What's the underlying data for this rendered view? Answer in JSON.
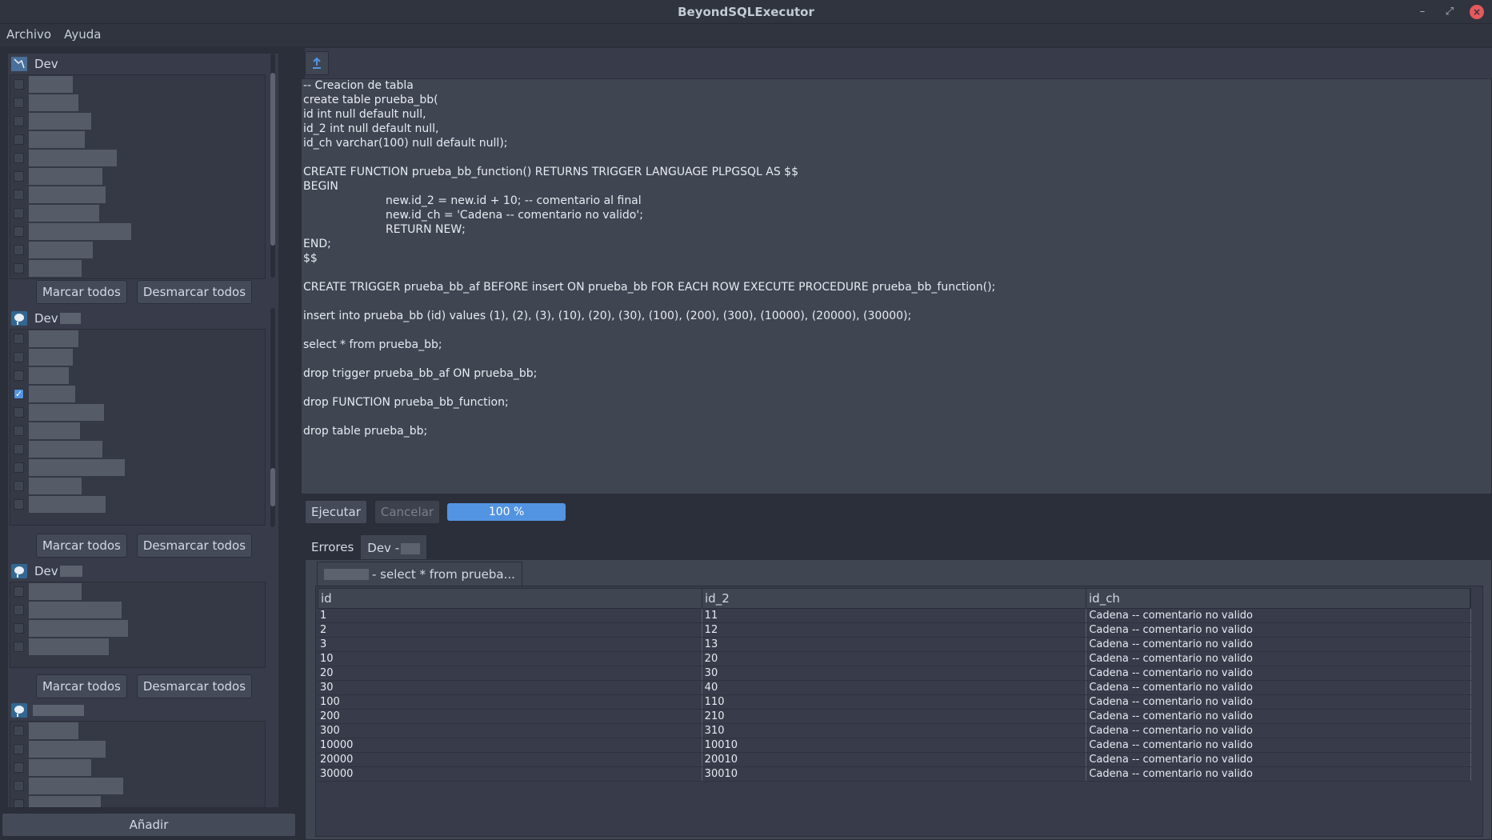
{
  "window": {
    "title": "BeyondSQLExecutor",
    "controls": [
      "minimize",
      "maximize",
      "close"
    ]
  },
  "menu": [
    "Archivo",
    "Ayuda"
  ],
  "left": {
    "groups": [
      {
        "name": "Dev",
        "icon": "connection-icon",
        "mark_all": "Marcar todos",
        "unmark_all": "Desmarcar todos"
      },
      {
        "name": "Dev",
        "icon": "postgres-icon",
        "mark_all": "Marcar todos",
        "unmark_all": "Desmarcar todos"
      },
      {
        "name": "Dev",
        "icon": "postgres-icon",
        "mark_all": "Marcar todos",
        "unmark_all": "Desmarcar todos"
      },
      {
        "name": "",
        "icon": "postgres-icon"
      }
    ],
    "add_button": "Añadir"
  },
  "editor": {
    "upload_icon": "upload-icon",
    "lines": [
      "-- Creacion de tabla",
      "create table prueba_bb(",
      "id int null default null,",
      "id_2 int null default null,",
      "id_ch varchar(100) null default null);",
      "",
      "CREATE FUNCTION prueba_bb_function() RETURNS TRIGGER LANGUAGE PLPGSQL AS $$",
      "BEGIN",
      "new.id_2 = new.id + 10; -- comentario al final",
      "new.id_ch = 'Cadena -- comentario no valido';",
      "RETURN NEW;",
      "END;",
      "$$",
      "",
      "CREATE TRIGGER prueba_bb_af BEFORE insert ON prueba_bb FOR EACH ROW EXECUTE PROCEDURE prueba_bb_function();",
      "",
      "insert into prueba_bb (id) values (1), (2), (3), (10), (20), (30), (100), (200), (300), (10000), (20000), (30000);",
      "",
      "select * from prueba_bb;",
      "",
      "drop trigger prueba_bb_af ON prueba_bb;",
      "",
      "drop FUNCTION prueba_bb_function;",
      "",
      "drop table prueba_bb;"
    ]
  },
  "execution": {
    "run_label": "Ejecutar",
    "cancel_label": "Cancelar",
    "progress_label": "100 %",
    "progress_value": 1.0
  },
  "results": {
    "tabs": [
      "Errores",
      "Dev -"
    ],
    "active_tab": 1,
    "subtab_label": "- select * from prueba...",
    "columns": [
      "id",
      "id_2",
      "id_ch"
    ],
    "rows": [
      [
        "1",
        "11",
        "Cadena -- comentario no valido"
      ],
      [
        "2",
        "12",
        "Cadena -- comentario no valido"
      ],
      [
        "3",
        "13",
        "Cadena -- comentario no valido"
      ],
      [
        "10",
        "20",
        "Cadena -- comentario no valido"
      ],
      [
        "20",
        "30",
        "Cadena -- comentario no valido"
      ],
      [
        "30",
        "40",
        "Cadena -- comentario no valido"
      ],
      [
        "100",
        "110",
        "Cadena -- comentario no valido"
      ],
      [
        "200",
        "210",
        "Cadena -- comentario no valido"
      ],
      [
        "300",
        "310",
        "Cadena -- comentario no valido"
      ],
      [
        "10000",
        "10010",
        "Cadena -- comentario no valido"
      ],
      [
        "20000",
        "20010",
        "Cadena -- comentario no valido"
      ],
      [
        "30000",
        "30010",
        "Cadena -- comentario no valido"
      ]
    ]
  },
  "colors": {
    "accent": "#5294e2",
    "background": "#383c4a",
    "editor_bg": "#404552",
    "close": "#e7585d"
  }
}
